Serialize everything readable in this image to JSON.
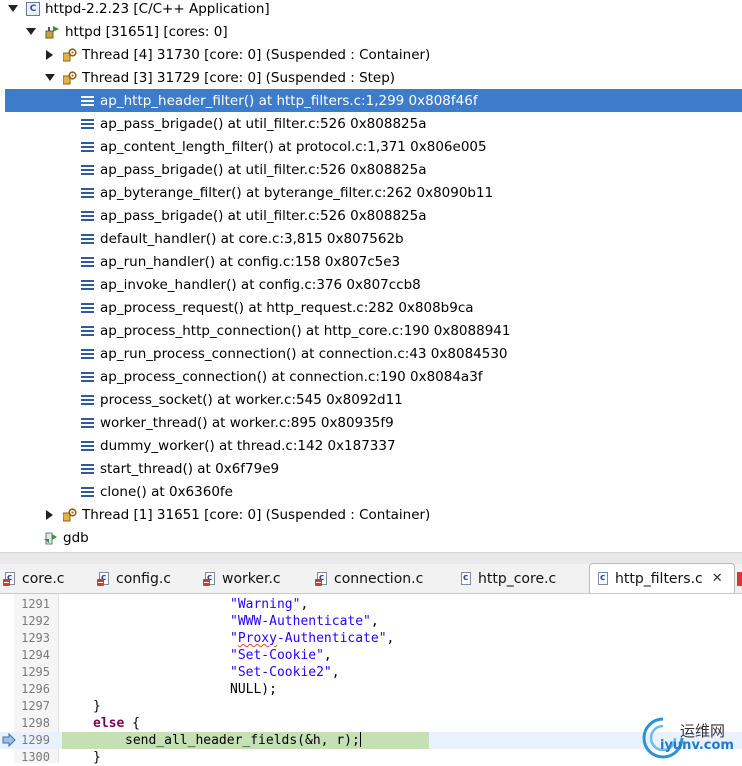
{
  "debug_tree": {
    "application_label": "httpd-2.2.23 [C/C++ Application]",
    "process_label": "httpd [31651] [cores: 0]",
    "threads": [
      {
        "label": "Thread [4] 31730 [core: 0] (Suspended : Container)",
        "expanded": false
      },
      {
        "label": "Thread [3] 31729 [core: 0] (Suspended : Step)",
        "expanded": true
      },
      {
        "label": "Thread [1] 31651 [core: 0] (Suspended : Container)",
        "expanded": false
      }
    ],
    "frames": [
      "ap_http_header_filter() at http_filters.c:1,299 0x808f46f",
      "ap_pass_brigade() at util_filter.c:526 0x808825a",
      "ap_content_length_filter() at protocol.c:1,371 0x806e005",
      "ap_pass_brigade() at util_filter.c:526 0x808825a",
      "ap_byterange_filter() at byterange_filter.c:262 0x8090b11",
      "ap_pass_brigade() at util_filter.c:526 0x808825a",
      "default_handler() at core.c:3,815 0x807562b",
      "ap_run_handler() at config.c:158 0x807c5e3",
      "ap_invoke_handler() at config.c:376 0x807ccb8",
      "ap_process_request() at http_request.c:282 0x808b9ca",
      "ap_process_http_connection() at http_core.c:190 0x8088941",
      "ap_run_process_connection() at connection.c:43 0x8084530",
      "ap_process_connection() at connection.c:190 0x8084a3f",
      "process_socket() at worker.c:545 0x8092d11",
      "worker_thread() at worker.c:895 0x80935f9",
      "dummy_worker() at thread.c:142 0x187337",
      "start_thread() at 0x6f79e9",
      "clone() at 0x6360fe"
    ],
    "gdb_label": "gdb"
  },
  "editor_tabs": [
    {
      "label": "core.c",
      "has_error": true,
      "active": false
    },
    {
      "label": "config.c",
      "has_error": true,
      "active": false
    },
    {
      "label": "worker.c",
      "has_error": true,
      "active": false
    },
    {
      "label": "connection.c",
      "has_error": true,
      "active": false
    },
    {
      "label": "http_core.c",
      "has_error": false,
      "active": false
    },
    {
      "label": "http_filters.c",
      "has_error": false,
      "active": true
    }
  ],
  "tab_close_glyph": "✕",
  "editor": {
    "line_numbers": [
      "1291",
      "1292",
      "1293",
      "1294",
      "1295",
      "1296",
      "1297",
      "1298",
      "1299",
      "1300"
    ],
    "code": {
      "l1291": "\"Warning\"",
      "l1292": "\"WWW-Authenticate\"",
      "l1293a": "\"",
      "l1293b": "Proxy",
      "l1293c": "-Authenticate\"",
      "l1294": "\"Set-Cookie\"",
      "l1295": "\"Set-Cookie2\"",
      "l1296": "NULL);",
      "l1297": "}",
      "l1298_kw": "else",
      "l1298_rest": " {",
      "l1299": "send_all_header_fields(&h, r);",
      "l1300": "}"
    },
    "current_line": "1299"
  },
  "watermark": {
    "cn": "运维网",
    "url": "iyunv.com"
  },
  "colors": {
    "selection": "#3d7cc9",
    "string": "#2a00ff",
    "keyword": "#7f0055",
    "current_line_highlight": "#c5e0b4"
  }
}
